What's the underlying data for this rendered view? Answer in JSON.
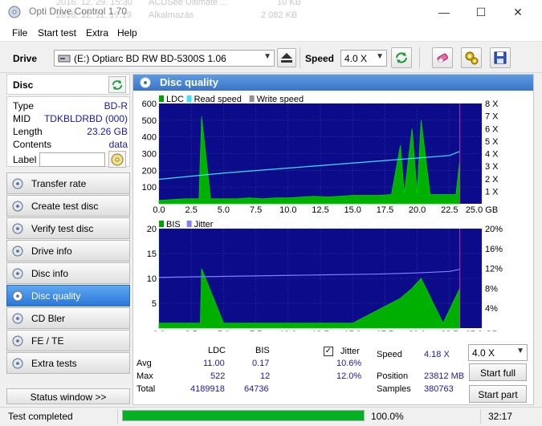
{
  "background_rows": [
    {
      "a": "2016. 12. 29. 15:30",
      "b": "ACDSee Ultimate ...",
      "c": "10 KB"
    },
    {
      "a": "2016. 12. 11. 17:19",
      "b": "Alkalmazás",
      "c": "2 082 KB"
    }
  ],
  "window": {
    "title": "Opti Drive Control 1.70",
    "minimize": "—",
    "maximize": "☐",
    "close": "✕"
  },
  "menu": [
    "File",
    "Start test",
    "Extra",
    "Help"
  ],
  "toolbar": {
    "drive_label": "Drive",
    "drive_value": "(E:)  Optiarc BD RW BD-5300S 1.06",
    "speed_label": "Speed",
    "speed_value": "4.0 X",
    "icons": [
      "refresh-icon",
      "eject-icon",
      "eraser-icon",
      "settings-icon",
      "save-icon"
    ]
  },
  "disc": {
    "header": "Disc",
    "rows": [
      {
        "key": "Type",
        "value": "BD-R"
      },
      {
        "key": "MID",
        "value": "TDKBLDRBD (000)"
      },
      {
        "key": "Length",
        "value": "23.26 GB"
      },
      {
        "key": "Contents",
        "value": "data"
      }
    ],
    "label_key": "Label",
    "label_value": ""
  },
  "nav": [
    {
      "label": "Transfer rate",
      "active": false
    },
    {
      "label": "Create test disc",
      "active": false
    },
    {
      "label": "Verify test disc",
      "active": false
    },
    {
      "label": "Drive info",
      "active": false
    },
    {
      "label": "Disc info",
      "active": false
    },
    {
      "label": "Disc quality",
      "active": true
    },
    {
      "label": "CD Bler",
      "active": false
    },
    {
      "label": "FE / TE",
      "active": false
    },
    {
      "label": "Extra tests",
      "active": false
    }
  ],
  "status_window_label": "Status window >>",
  "panel_title": "Disc quality",
  "chart_data": [
    {
      "type": "line",
      "legend": [
        {
          "name": "LDC",
          "color": "#00a000"
        },
        {
          "name": "Read speed",
          "color": "#40e0ff"
        },
        {
          "name": "Write speed",
          "color": "#909090"
        }
      ],
      "xlim": [
        0,
        25
      ],
      "x_ticks": [
        "0.0",
        "2.5",
        "5.0",
        "7.5",
        "10.0",
        "12.5",
        "15.0",
        "17.5",
        "20.0",
        "22.5",
        "25.0 GB"
      ],
      "ylim": [
        0,
        600
      ],
      "y_ticks": [
        "100",
        "200",
        "300",
        "400",
        "500",
        "600"
      ],
      "y2lim": [
        0,
        8
      ],
      "y2_ticks": [
        "1 X",
        "2 X",
        "3 X",
        "4 X",
        "5 X",
        "6 X",
        "7 X",
        "8 X"
      ],
      "series": [
        {
          "name": "LDC",
          "x": [
            0,
            1,
            2,
            3.1,
            3.3,
            4,
            5,
            6,
            7,
            8,
            9,
            10,
            11,
            12,
            13,
            14,
            15,
            16,
            17,
            18,
            18.7,
            19,
            19.6,
            20,
            20.3,
            21,
            22,
            23,
            23.3
          ],
          "y": [
            20,
            25,
            30,
            30,
            522,
            30,
            30,
            30,
            35,
            30,
            35,
            35,
            40,
            45,
            40,
            45,
            50,
            50,
            50,
            55,
            350,
            60,
            450,
            60,
            500,
            55,
            55,
            55,
            260
          ]
        },
        {
          "name": "Read speed",
          "x": [
            0,
            2.5,
            5,
            7.5,
            10,
            12.5,
            15,
            17.5,
            20,
            22.5,
            23.3
          ],
          "y": [
            1.95,
            2.2,
            2.45,
            2.65,
            2.85,
            3.05,
            3.25,
            3.45,
            3.65,
            3.85,
            4.18
          ]
        }
      ]
    },
    {
      "type": "line",
      "legend": [
        {
          "name": "BIS",
          "color": "#00a000"
        },
        {
          "name": "Jitter",
          "color": "#8080ff"
        }
      ],
      "xlim": [
        0,
        25
      ],
      "x_ticks": [
        "0.0",
        "2.5",
        "5.0",
        "7.5",
        "10.0",
        "12.5",
        "15.0",
        "17.5",
        "20.0",
        "22.5",
        "25.0 GB"
      ],
      "ylim": [
        0,
        20
      ],
      "y_ticks": [
        "5",
        "10",
        "15",
        "20"
      ],
      "y2lim": [
        0,
        20
      ],
      "y2_ticks": [
        "4%",
        "8%",
        "12%",
        "16%",
        "20%"
      ],
      "series": [
        {
          "name": "BIS",
          "x": [
            0,
            3.2,
            3.3,
            5,
            10,
            15,
            18.7,
            19.6,
            20.3,
            22,
            23.3
          ],
          "y": [
            1,
            1,
            12,
            1,
            1,
            1,
            6,
            8,
            10,
            1,
            8
          ]
        },
        {
          "name": "Jitter",
          "x": [
            0,
            2.5,
            5,
            7.5,
            10,
            12.5,
            15,
            17.5,
            20,
            22.5,
            23.3
          ],
          "y": [
            10.2,
            10.3,
            10.4,
            10.5,
            10.6,
            10.7,
            10.8,
            10.9,
            11.1,
            11.4,
            11.8
          ]
        }
      ]
    }
  ],
  "stats": {
    "col_ldc": "LDC",
    "col_bis": "BIS",
    "col_jitter": "Jitter",
    "avg_label": "Avg",
    "avg_ldc": "11.00",
    "avg_bis": "0.17",
    "avg_jitter": "10.6%",
    "max_label": "Max",
    "max_ldc": "522",
    "max_bis": "12",
    "max_jitter": "12.0%",
    "total_label": "Total",
    "total_ldc": "4189918",
    "total_bis": "64736",
    "jitter_checked": "✓",
    "speed_label": "Speed",
    "speed_value": "4.18 X",
    "position_label": "Position",
    "position_value": "23812 MB",
    "samples_label": "Samples",
    "samples_value": "380763",
    "speed_select": "4.0 X",
    "start_full": "Start full",
    "start_part": "Start part"
  },
  "status": {
    "text": "Test completed",
    "progress_pct": 100,
    "progress_text": "100.0%",
    "time": "32:17"
  }
}
